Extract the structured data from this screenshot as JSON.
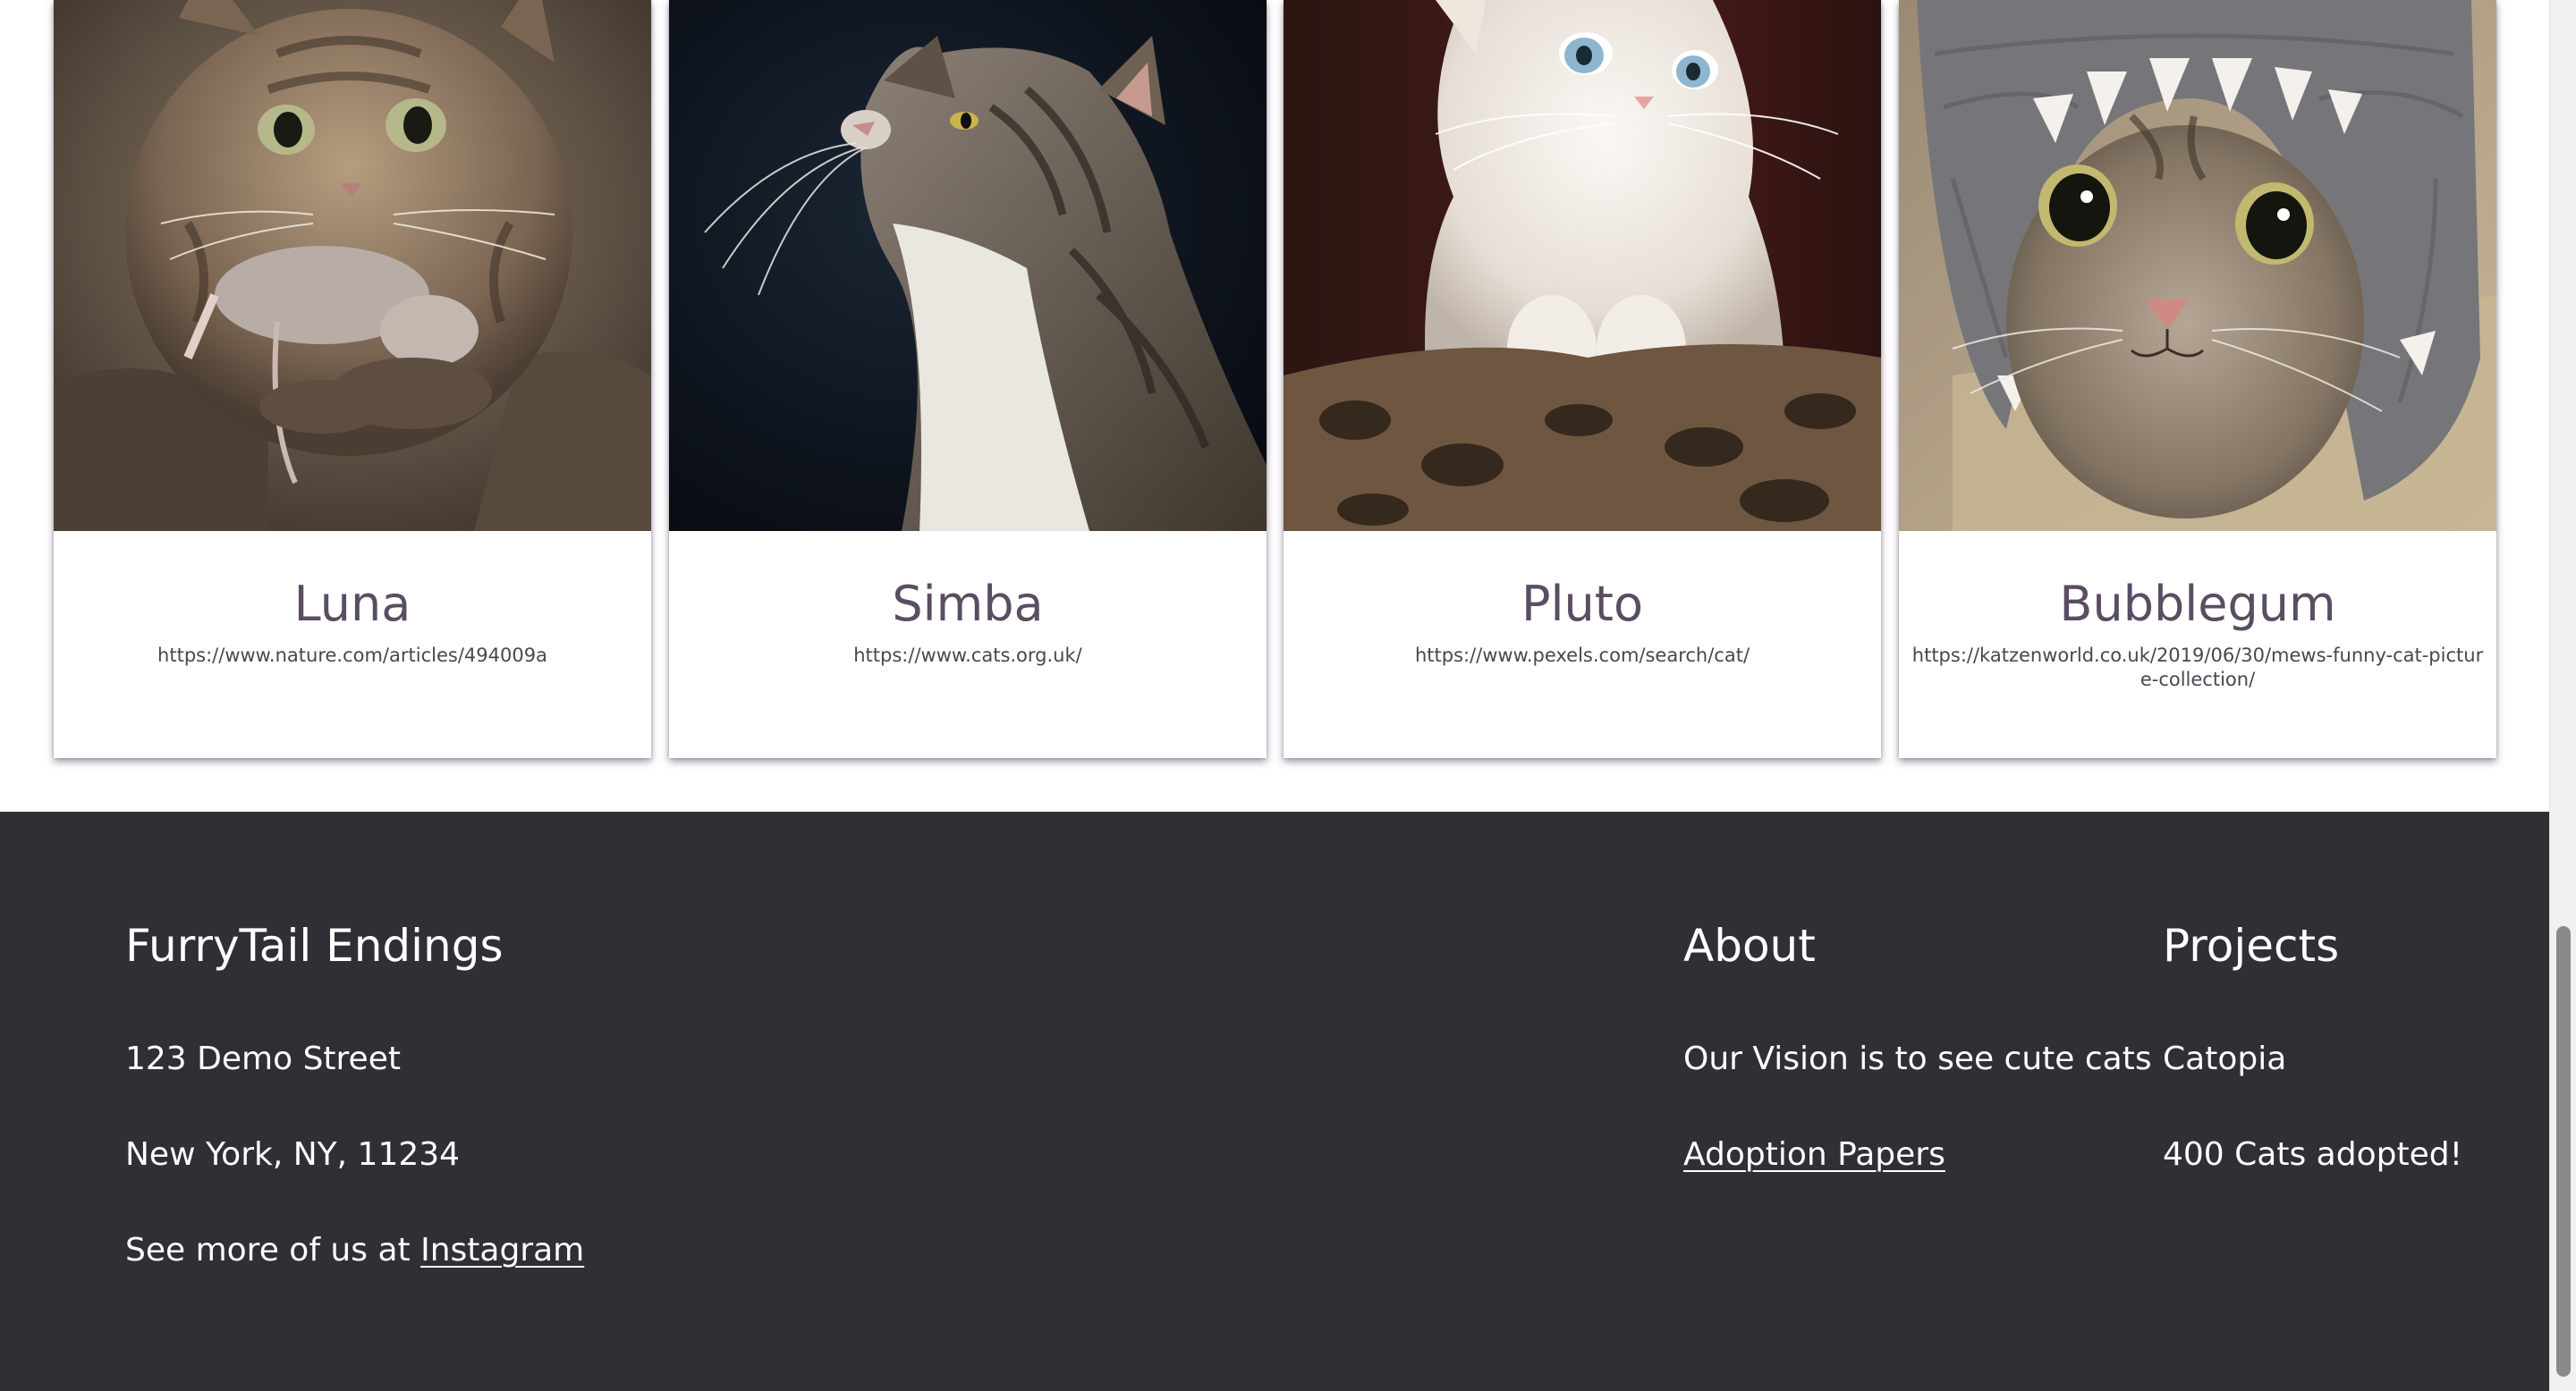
{
  "cards": [
    {
      "name": "Luna",
      "url": "https://www.nature.com/articles/494009a",
      "image": "tabby-cat-holding-mouse-photo"
    },
    {
      "name": "Simba",
      "url": "https://www.cats.org.uk/",
      "image": "tabby-cat-looking-up-photo"
    },
    {
      "name": "Pluto",
      "url": "https://www.pexels.com/search/cat/",
      "image": "white-kitten-photo"
    },
    {
      "name": "Bubblegum",
      "url": "https://katzenworld.co.uk/2019/06/30/mews-funny-cat-picture-collection/",
      "image": "cat-in-shark-hat-photo"
    }
  ],
  "footer": {
    "brand": {
      "title": "FurryTail Endings",
      "street": "123 Demo Street",
      "city": "New York, NY, 11234",
      "social_prefix": "See more of us at ",
      "social_link": "Instagram"
    },
    "about": {
      "title": "About",
      "vision": "Our Vision is to see cute cats",
      "adoption_link": "Adoption Papers"
    },
    "projects": {
      "title": "Projects",
      "project_name": "Catopia",
      "adopted": "400 Cats adopted!"
    }
  },
  "colors": {
    "footer_bg": "#302f35",
    "card_title": "#5a4d63",
    "card_shadow": "#543e5c"
  }
}
